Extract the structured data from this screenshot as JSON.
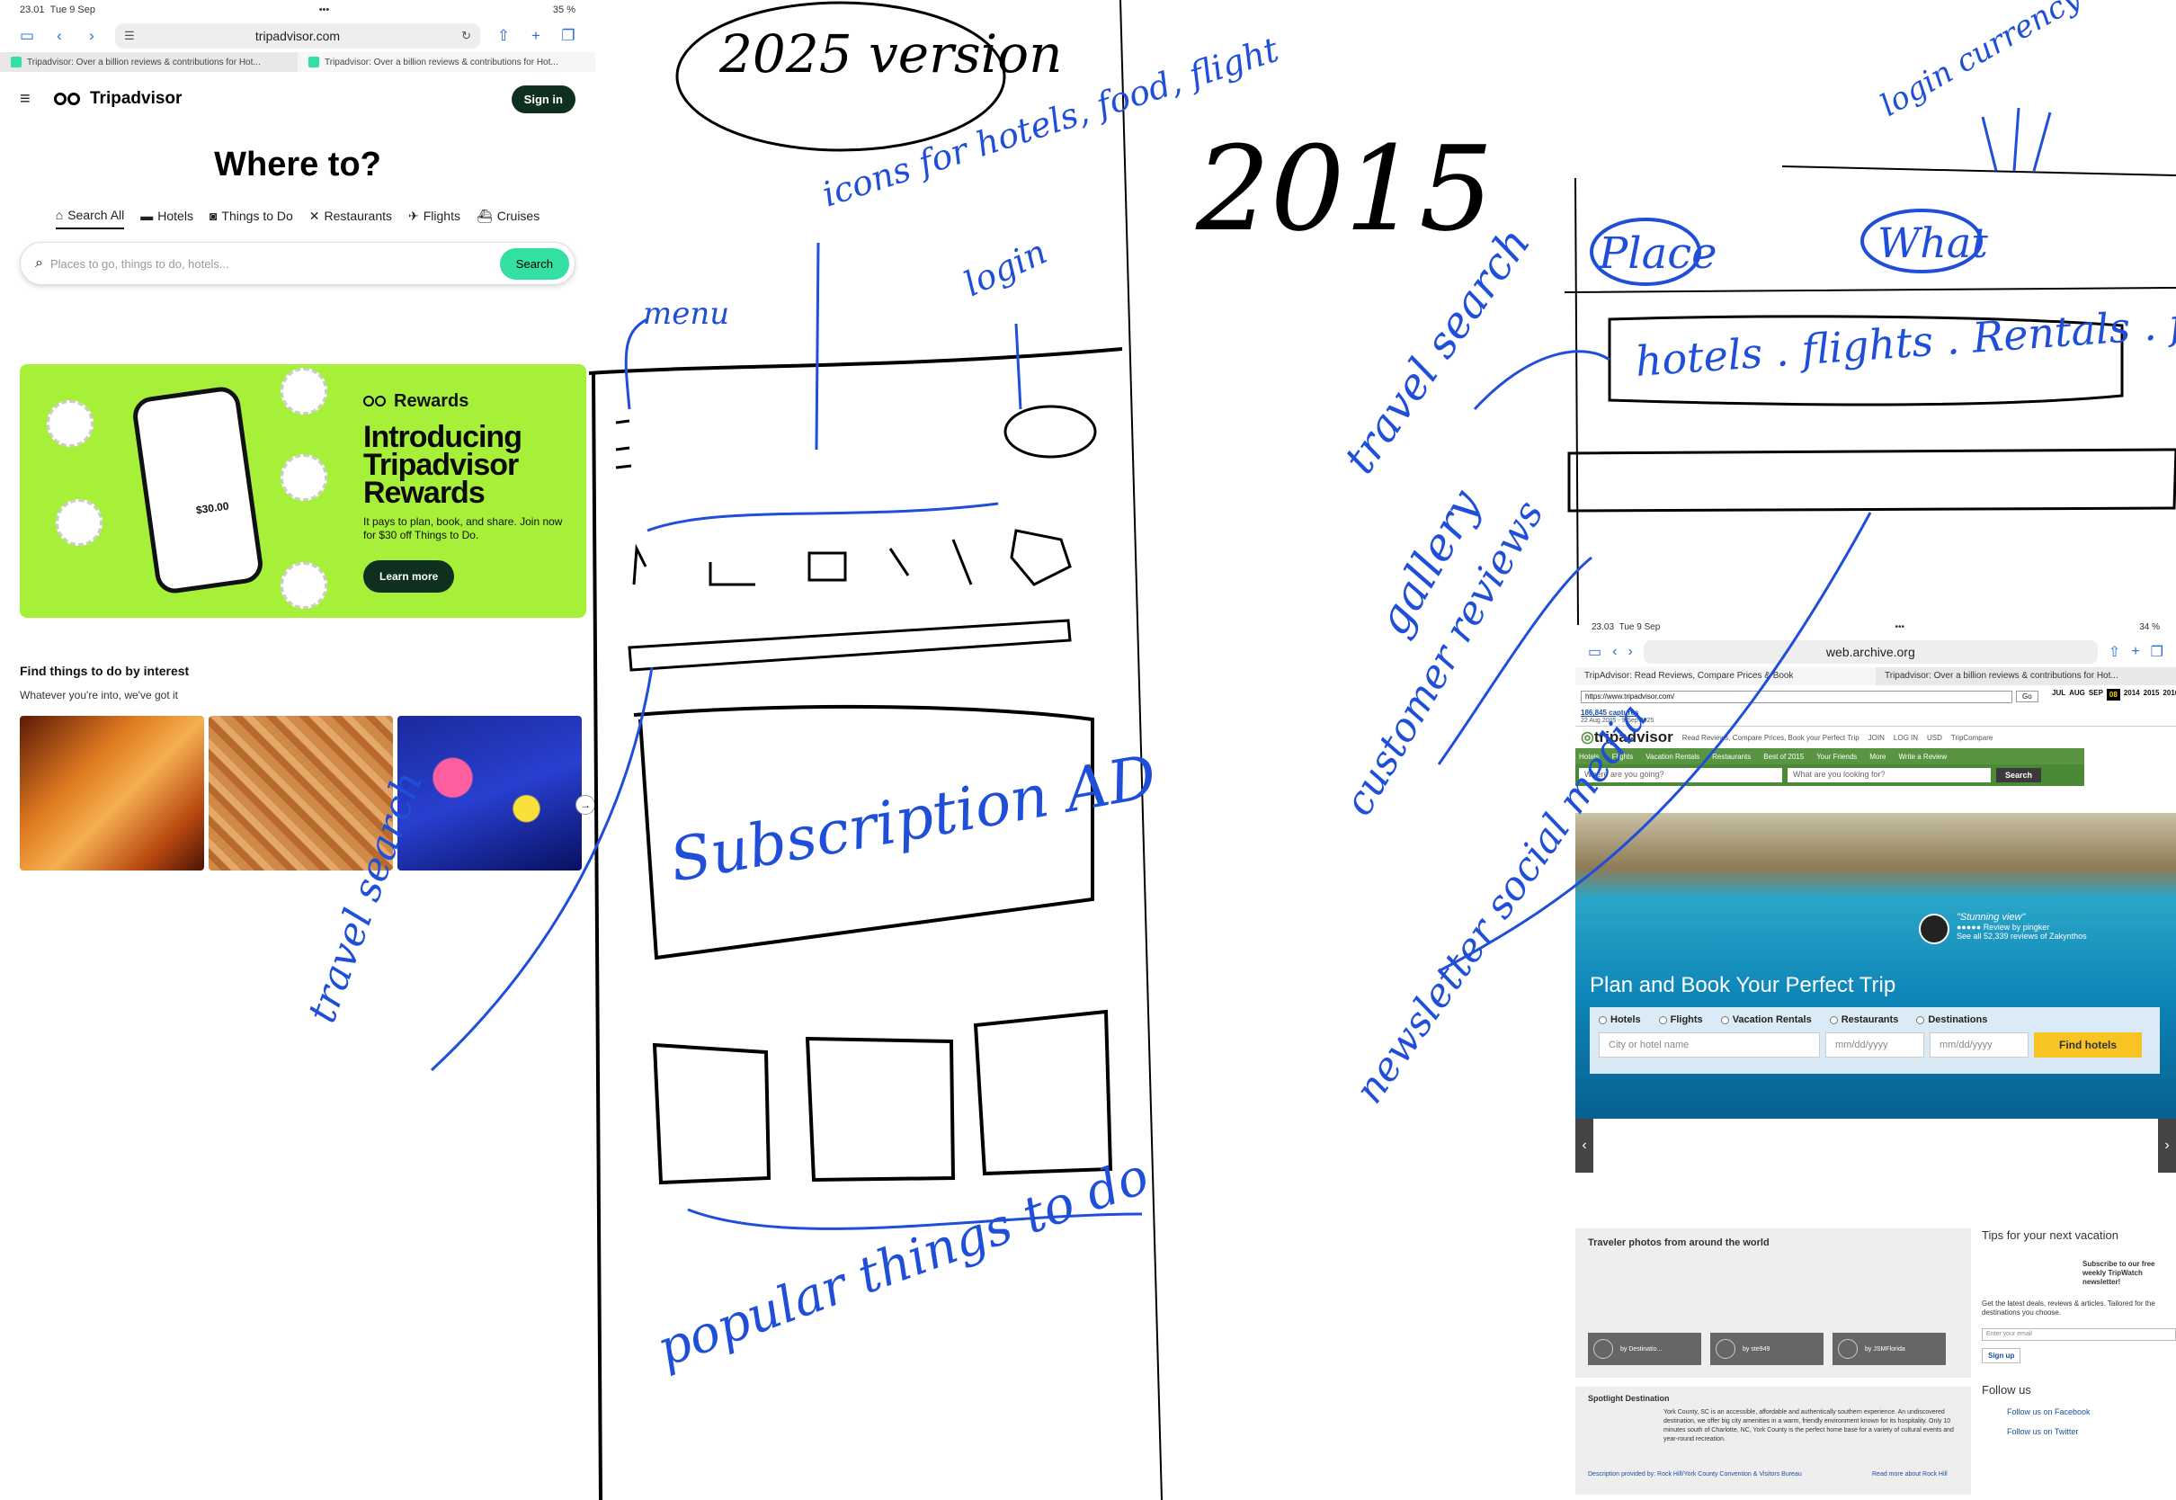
{
  "left_screen": {
    "status": {
      "time": "23.01",
      "date": "Tue 9 Sep",
      "battery": "35 %"
    },
    "url": "tripadvisor.com",
    "tabs": [
      "Tripadvisor: Over a billion reviews & contributions for Hot...",
      "Tripadvisor: Over a billion reviews & contributions for Hot..."
    ],
    "brand": "Tripadvisor",
    "signin": "Sign in",
    "headline": "Where to?",
    "categories": [
      "Search All",
      "Hotels",
      "Things to Do",
      "Restaurants",
      "Flights",
      "Cruises"
    ],
    "search_placeholder": "Places to go, things to do, hotels...",
    "search_button": "Search",
    "rewards": {
      "logo": "Rewards",
      "title": "Introducing Tripadvisor Rewards",
      "body": "It pays to plan, book, and share. Join now for $30 off Things to Do.",
      "button": "Learn more",
      "phone_amount": "$30.00"
    },
    "interest_title": "Find things to do by interest",
    "interest_sub": "Whatever you're into, we've got it"
  },
  "sketch": {
    "version_bubble": "2025 version",
    "year_label": "2015",
    "notes_left": [
      "menu",
      "icons for hotels, food, flight",
      "login",
      "travel search",
      "Subscription AD",
      "popular things to do",
      "login"
    ],
    "notes_right": [
      "login currency cart",
      "Place",
      "What",
      "hotels . flights . Rentals . food",
      "travel search",
      "gallery",
      "customer reviews",
      "newsletter social media"
    ]
  },
  "right_screen": {
    "status": {
      "time": "23.03",
      "date": "Tue 9 Sep",
      "battery": "34 %"
    },
    "url": "web.archive.org",
    "tabs": [
      "TripAdvisor: Read Reviews, Compare Prices & Book",
      "Tripadvisor: Over a billion reviews & contributions for Hot..."
    ],
    "wayback": {
      "url": "https://www.tripadvisor.com/",
      "go": "Go",
      "captures": "186,845 captures",
      "range": "22 Aug 2005 - 9 Sep 2025",
      "months": [
        "JUL",
        "AUG",
        "SEP"
      ],
      "day": "08",
      "years": [
        "2014",
        "2015",
        "2016"
      ]
    },
    "top_links": [
      "Read Reviews, Compare Prices, Book your Perfect Trip",
      "JOIN",
      "LOG IN",
      "USD",
      "TripCompare"
    ],
    "brand": "tripadvisor",
    "nav": [
      "Hotels",
      "Flights",
      "Vacation Rentals",
      "Restaurants",
      "Best of 2015",
      "Your Friends",
      "More",
      "Write a Review"
    ],
    "where_placeholder": "Where are you going?",
    "what_placeholder": "What are you looking for?",
    "search_button": "Search",
    "review_quote": "\"Stunning view\"",
    "review_by": "Review by pingker",
    "review_link": "See all 52,339 reviews of Zakynthos",
    "hero_title": "Plan and Book Your Perfect Trip",
    "radio_options": [
      "Hotels",
      "Flights",
      "Vacation Rentals",
      "Restaurants",
      "Destinations"
    ],
    "city_placeholder": "City or hotel name",
    "date_placeholder": "mm/dd/yyyy",
    "find_button": "Find hotels",
    "photos_title": "Traveler photos from around the world",
    "photo_credits": [
      "by Destinatio...",
      "by ste949",
      "by JSMFlorida"
    ],
    "spotlight_title": "Spotlight Destination",
    "spotlight_text": "York County, SC is an accessible, affordable and authentically southern experience. An undiscovered destination, we offer big city amenities in a warm, friendly environment known for its hospitality. Only 10 minutes south of Charlotte, NC, York County is the perfect home base for a variety of cultural events and year-round recreation.",
    "spotlight_source": "Description provided by: Rock Hill/York County Convention & Visitors Bureau",
    "spotlight_more": "Read more about Rock Hill",
    "tips_title": "Tips for your next vacation",
    "newsletter": "Subscribe to our free weekly TripWatch newsletter!",
    "newsletter_desc": "Get the latest deals, reviews & articles. Tailored for the destinations you choose.",
    "email_placeholder": "Enter your email",
    "signup": "Sign up",
    "follow_title": "Follow us",
    "follow_links": [
      "Follow us on Facebook",
      "Follow us on Twitter"
    ]
  }
}
